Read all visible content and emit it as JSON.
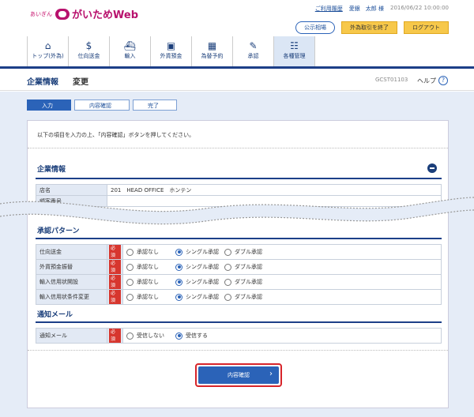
{
  "header": {
    "logo_small": "あいぎん",
    "logo_main": "がいためWeb",
    "links": {
      "history": "ご利用履歴",
      "user": "愛銀　太郎 様",
      "timestamp": "2016/06/22 10:00:00"
    },
    "buttons": {
      "rates": "公示相場",
      "end": "外為取引を終了",
      "logout": "ログアウト"
    }
  },
  "nav": [
    {
      "label": "トップ(外為)",
      "icon": "home-icon"
    },
    {
      "label": "仕向送金",
      "icon": "remittance-icon"
    },
    {
      "label": "輸入",
      "icon": "ship-icon"
    },
    {
      "label": "外貨預金",
      "icon": "deposit-icon"
    },
    {
      "label": "為替予約",
      "icon": "forex-icon"
    },
    {
      "label": "承認",
      "icon": "approve-icon"
    },
    {
      "label": "各種管理",
      "icon": "admin-icon"
    }
  ],
  "title_bar": {
    "section": "企業情報",
    "page": "変更",
    "screen_id": "GCST01103",
    "help": "ヘルプ"
  },
  "steps": [
    "入力",
    "内容確認",
    "完了"
  ],
  "instruction": "以下の項目を入力の上、「内容確認」ボタンを押してください。",
  "company_info": {
    "title": "企業情報",
    "rows": [
      {
        "label": "店名",
        "value": "201　HEAD OFFICE　ホンテン"
      },
      {
        "label": "顧客番号",
        "value": ""
      }
    ]
  },
  "approval": {
    "title": "承認パターン",
    "required": "必須",
    "options": [
      "承認なし",
      "シングル承認",
      "ダブル承認"
    ],
    "rows": [
      {
        "label": "仕向送金",
        "selected": 1
      },
      {
        "label": "外貨預金振替",
        "selected": 1
      },
      {
        "label": "輸入信用状開設",
        "selected": 1
      },
      {
        "label": "輸入信用状条件変更",
        "selected": 1
      }
    ]
  },
  "notification": {
    "title": "通知メール",
    "label": "通知メール",
    "required": "必須",
    "options": [
      "受信しない",
      "受信する"
    ],
    "selected": 1
  },
  "confirm_button": "内容確認"
}
